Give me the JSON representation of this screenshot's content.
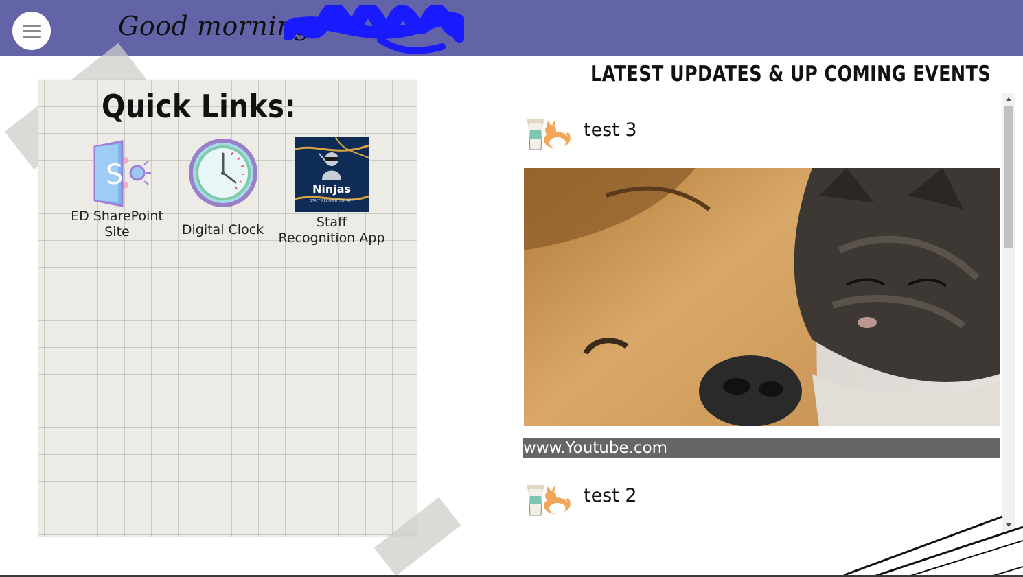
{
  "header": {
    "greeting": "Good morning,",
    "menu_icon": "hamburger-icon",
    "bg_color": "#6264a7",
    "redaction_color": "#1a1aff"
  },
  "quick_links": {
    "title": "Quick Links:",
    "items": [
      {
        "label_line1": "ED SharePoint",
        "label_line2": "Site",
        "icon": "sharepoint-icon"
      },
      {
        "label_line1": "Digital Clock",
        "label_line2": "",
        "icon": "clock-icon"
      },
      {
        "label_line1": "Staff",
        "label_line2": "Recognition App",
        "icon": "ninjas-app-icon",
        "icon_text": "Ninjas",
        "icon_subtext": "STAFF RECOGNITION APP"
      }
    ]
  },
  "feed": {
    "title": "LATEST UPDATES & UP COMING EVENTS",
    "posts": [
      {
        "title": "test 3",
        "image": "dog-and-kitten-photo",
        "link_text": "www.Youtube.com"
      },
      {
        "title": "test 2"
      }
    ]
  }
}
